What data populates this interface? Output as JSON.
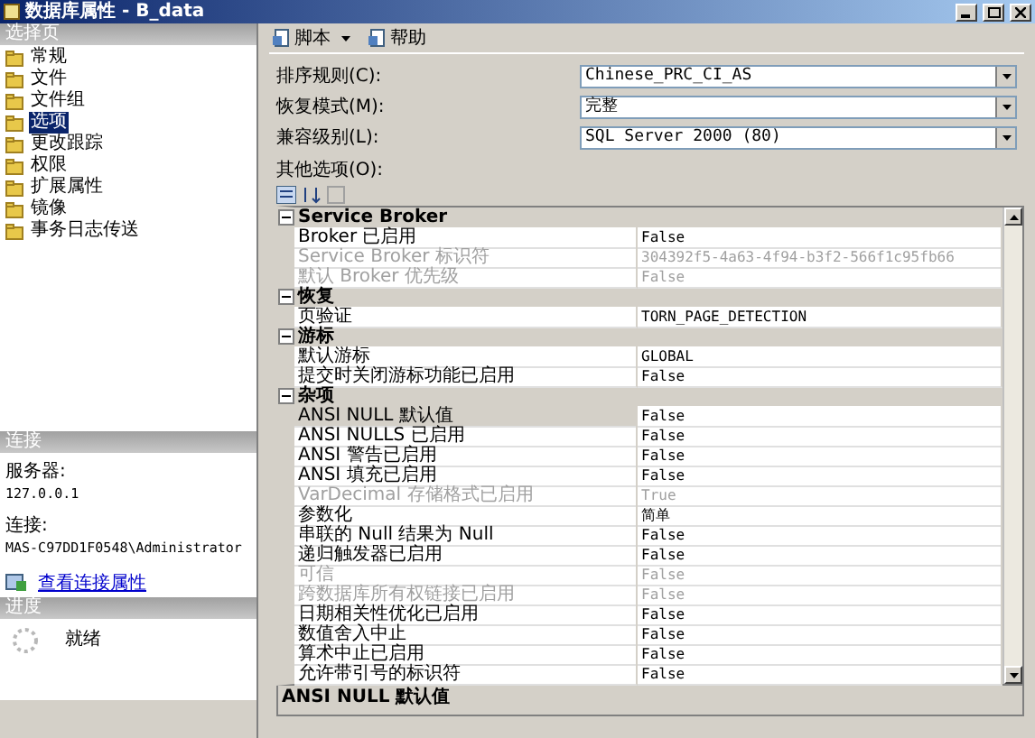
{
  "window": {
    "title": "数据库属性 - B_data"
  },
  "sidebar": {
    "header": "选择页",
    "items": [
      {
        "label": "常规",
        "selected": false
      },
      {
        "label": "文件",
        "selected": false
      },
      {
        "label": "文件组",
        "selected": false
      },
      {
        "label": "选项",
        "selected": true
      },
      {
        "label": "更改跟踪",
        "selected": false
      },
      {
        "label": "权限",
        "selected": false
      },
      {
        "label": "扩展属性",
        "selected": false
      },
      {
        "label": "镜像",
        "selected": false
      },
      {
        "label": "事务日志传送",
        "selected": false
      }
    ]
  },
  "connection": {
    "header": "连接",
    "server_label": "服务器:",
    "server": "127.0.0.1",
    "connection_label": "连接:",
    "connection": "MAS-C97DD1F0548\\Administrator",
    "link": "查看连接属性"
  },
  "progress": {
    "header": "进度",
    "status": "就绪"
  },
  "toolbar": [
    {
      "label": "脚本",
      "kind": "dropdown"
    },
    {
      "label": "帮助",
      "kind": "plain"
    }
  ],
  "fields": [
    {
      "label": "排序规则(C):",
      "value": "Chinese_PRC_CI_AS"
    },
    {
      "label": "恢复模式(M):",
      "value": "完整"
    },
    {
      "label": "兼容级别(L):",
      "value": "SQL Server 2000 (80)"
    }
  ],
  "other_options_label": "其他选项(O):",
  "grid": {
    "categories": [
      {
        "name": "Service Broker",
        "expanded": true,
        "rows": [
          {
            "name": "Broker 已启用",
            "value": "False",
            "disabled": false,
            "selected": false
          },
          {
            "name": "Service Broker 标识符",
            "value": "304392f5-4a63-4f94-b3f2-566f1c95fb66",
            "disabled": true,
            "selected": false
          },
          {
            "name": "默认 Broker 优先级",
            "value": "False",
            "disabled": true,
            "selected": false
          }
        ]
      },
      {
        "name": "恢复",
        "expanded": true,
        "rows": [
          {
            "name": "页验证",
            "value": "TORN_PAGE_DETECTION",
            "disabled": false,
            "selected": false
          }
        ]
      },
      {
        "name": "游标",
        "expanded": true,
        "rows": [
          {
            "name": "默认游标",
            "value": "GLOBAL",
            "disabled": false,
            "selected": false
          },
          {
            "name": "提交时关闭游标功能已启用",
            "value": "False",
            "disabled": false,
            "selected": false
          }
        ]
      },
      {
        "name": "杂项",
        "expanded": true,
        "rows": [
          {
            "name": "ANSI NULL 默认值",
            "value": "False",
            "disabled": false,
            "selected": true
          },
          {
            "name": "ANSI NULLS 已启用",
            "value": "False",
            "disabled": false,
            "selected": false
          },
          {
            "name": "ANSI 警告已启用",
            "value": "False",
            "disabled": false,
            "selected": false
          },
          {
            "name": "ANSI 填充已启用",
            "value": "False",
            "disabled": false,
            "selected": false
          },
          {
            "name": "VarDecimal 存储格式已启用",
            "value": "True",
            "disabled": true,
            "selected": false
          },
          {
            "name": "参数化",
            "value": "简单",
            "disabled": false,
            "selected": false
          },
          {
            "name": "串联的 Null 结果为 Null",
            "value": "False",
            "disabled": false,
            "selected": false
          },
          {
            "name": "递归触发器已启用",
            "value": "False",
            "disabled": false,
            "selected": false
          },
          {
            "name": "可信",
            "value": "False",
            "disabled": true,
            "selected": false
          },
          {
            "name": "跨数据库所有权链接已启用",
            "value": "False",
            "disabled": true,
            "selected": false
          },
          {
            "name": "日期相关性优化已启用",
            "value": "False",
            "disabled": false,
            "selected": false
          },
          {
            "name": "数值舍入中止",
            "value": "False",
            "disabled": false,
            "selected": false
          },
          {
            "name": "算术中止已启用",
            "value": "False",
            "disabled": false,
            "selected": false
          },
          {
            "name": "允许带引号的标识符",
            "value": "False",
            "disabled": false,
            "selected": false
          }
        ]
      }
    ]
  },
  "description": "ANSI NULL 默认值"
}
